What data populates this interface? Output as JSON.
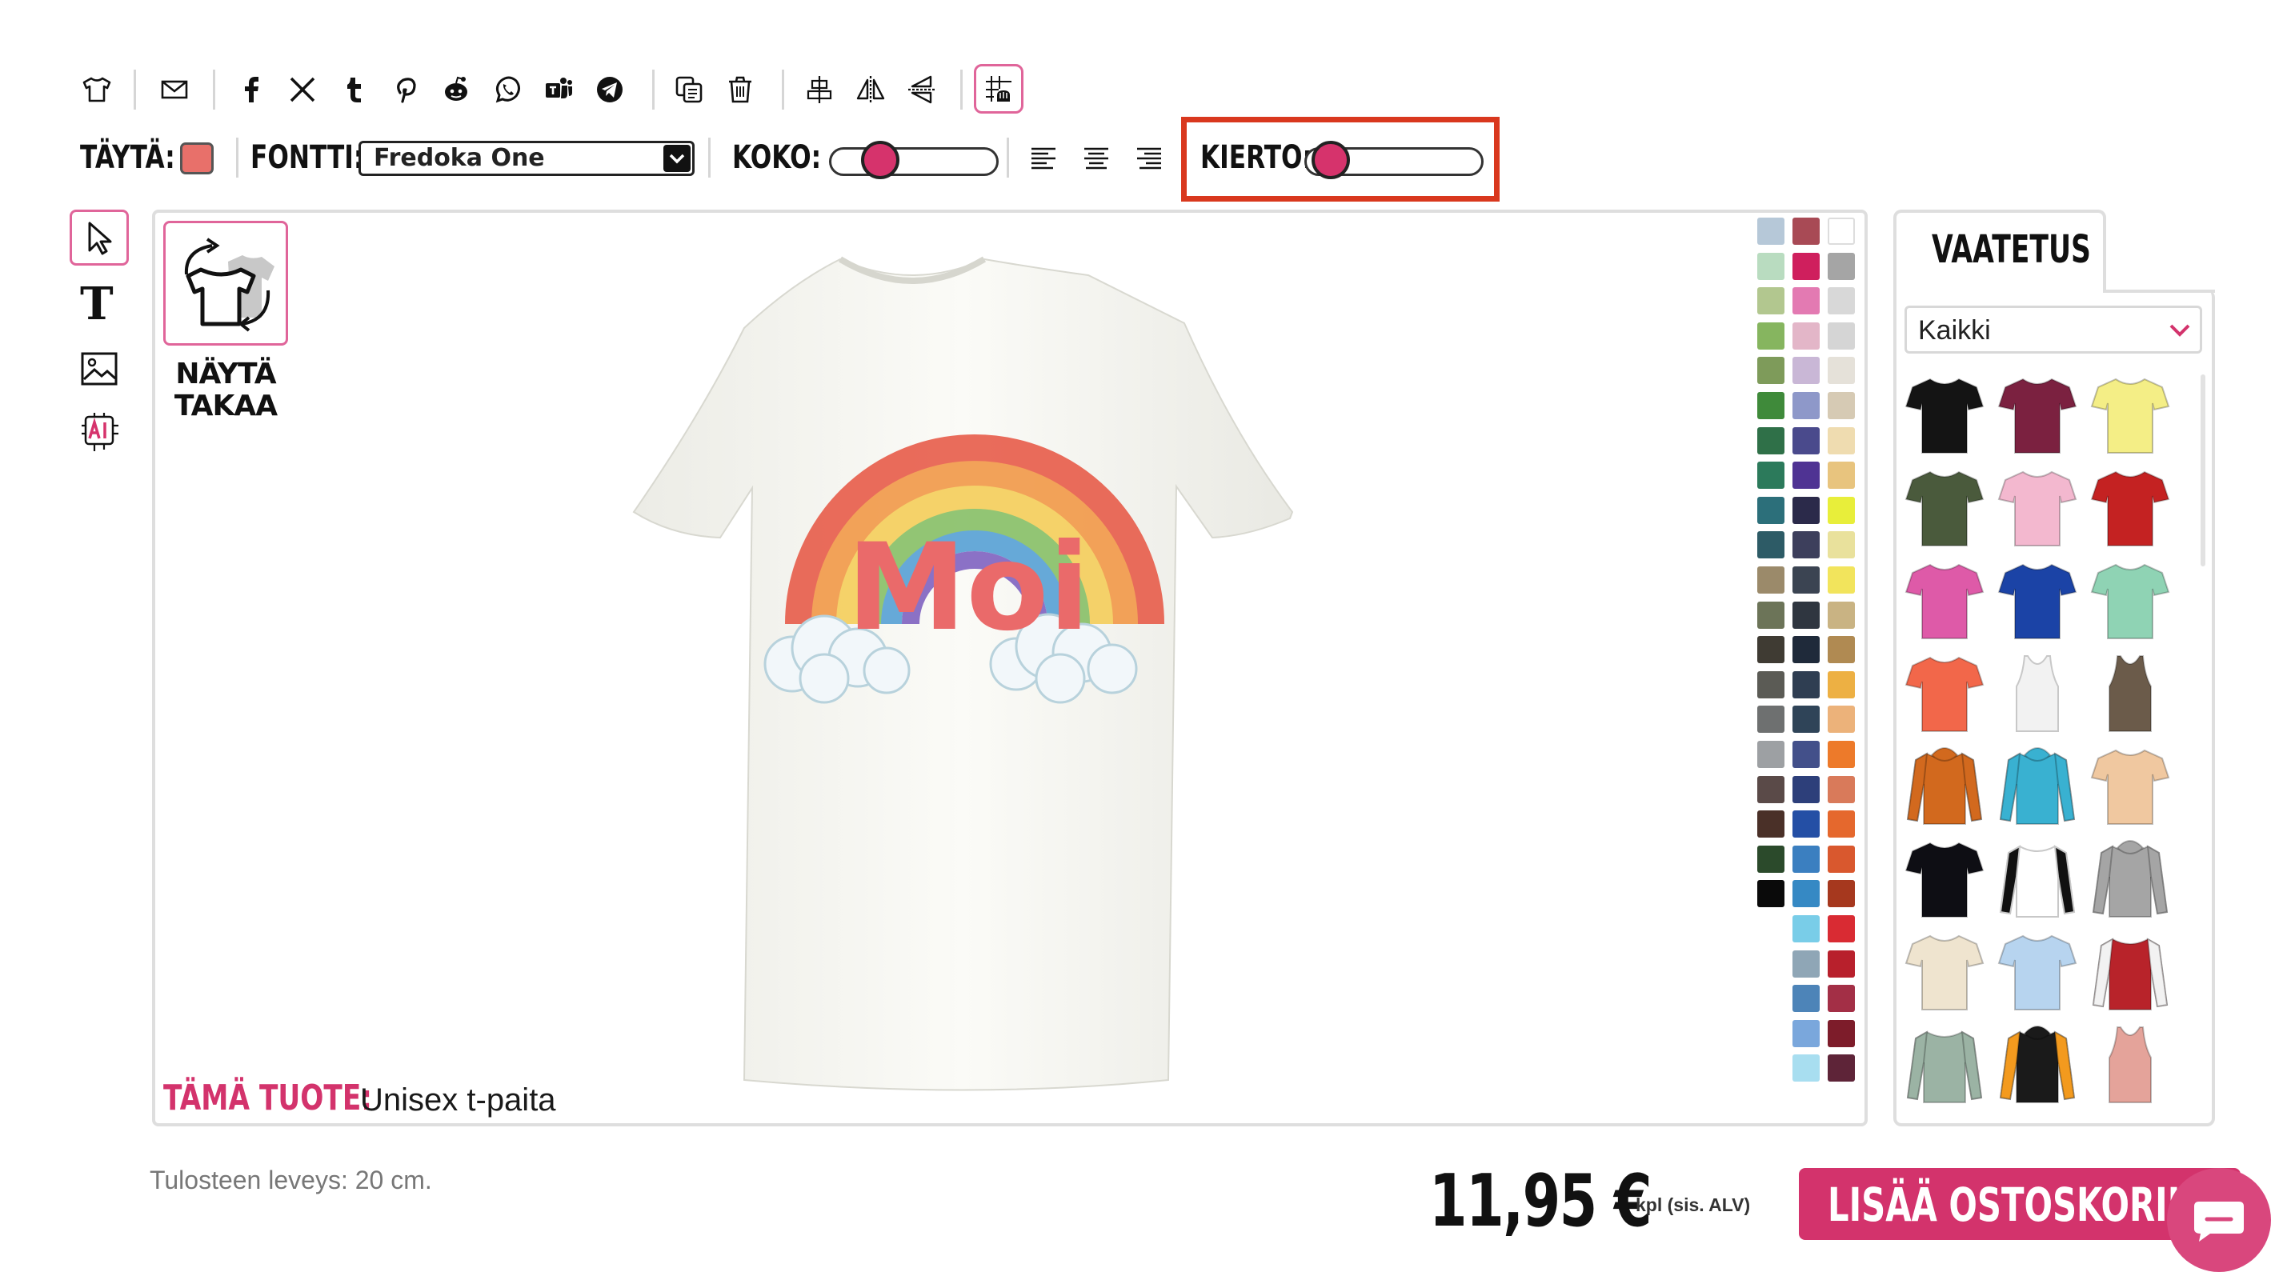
{
  "toolbar": {
    "icons": [
      "tshirt-icon",
      "mail-icon",
      "facebook-icon",
      "x-icon",
      "tumblr-icon",
      "pinterest-icon",
      "reddit-icon",
      "whatsapp-icon",
      "teams-icon",
      "telegram-icon",
      "copy-icon",
      "trash-icon",
      "align-center-icon",
      "flip-horizontal-icon",
      "flip-vertical-icon",
      "grid-snap-icon"
    ],
    "fill_label": "TÄYTÄ:",
    "fill_color": "#e8706a",
    "font_label": "FONTTI:",
    "font_value": "Fredoka One",
    "size_label": "KOKO:",
    "size_level": 0.25,
    "rotation_label": "KIERTO:",
    "rotation_level": 0.05
  },
  "tools": {
    "items": [
      "pointer-icon",
      "text-tool-icon",
      "image-tool-icon",
      "ai-tool-icon"
    ]
  },
  "canvas": {
    "show_back_label": "NÄYTÄ TAKAA",
    "design_text": "Moi",
    "product_label": "TÄMÄ TUOTE:",
    "product_name": "Unisex t-paita",
    "annotation_color": "#d9381e"
  },
  "colors": {
    "col1": [
      "#b6c8d8",
      "#b9dcc0",
      "#b2c78f",
      "#86b55f",
      "#7e9b5a",
      "#3f8a3a",
      "#2f7048",
      "#2c7a5b",
      "#2c6f7a",
      "#2d5b66",
      "#9b8a6a",
      "#6c7458",
      "#3f3b33",
      "#5b5b55",
      "#6e7070",
      "#9da0a3",
      "#5a4a48",
      "#4a3028",
      "#2b4a2b",
      "#0a0a0a"
    ],
    "col2": [
      "#a84a55",
      "#cf1f5d",
      "#e37ab2",
      "#e3b6c8",
      "#c9b7d6",
      "#8e98c9",
      "#4a4a8c",
      "#4f3393",
      "#2b2a4a",
      "#3d3f5c",
      "#3b4452",
      "#2f3640",
      "#1f2a3a",
      "#2f3e52",
      "#2f4458",
      "#43508a",
      "#2d3f7a",
      "#244fa5",
      "#3b7fc0",
      "#3689c4",
      "#79cde8",
      "#8fa6b6",
      "#4d84b8",
      "#7aa7dc",
      "#a8def0"
    ],
    "col3": [
      "#ffffff",
      "#a5a5a5",
      "#d8d8d8",
      "#d5d5d5",
      "#e5e1d9",
      "#d6cab4",
      "#efdcb0",
      "#e8c47e",
      "#e8ee3a",
      "#e9e19c",
      "#f2e45c",
      "#c9b383",
      "#b08a52",
      "#edb043",
      "#ecb27a",
      "#ed7a2a",
      "#d97a5a",
      "#e5682d",
      "#d9582e",
      "#a6381e",
      "#d92b33",
      "#b8202c",
      "#a32f46",
      "#7d1c2a",
      "#5e2438"
    ]
  },
  "clothing": {
    "tab_label": "VAATETUS",
    "category_value": "Kaikki",
    "items": [
      {
        "name": "black-tshirt",
        "color": "#141414"
      },
      {
        "name": "burgundy-tshirt",
        "color": "#7b2140"
      },
      {
        "name": "yellow-tshirt",
        "color": "#f4ee86"
      },
      {
        "name": "olive-tshirt",
        "color": "#4a5a3c"
      },
      {
        "name": "pink-tshirt",
        "color": "#f3b8cf"
      },
      {
        "name": "red-tshirt",
        "color": "#c42222"
      },
      {
        "name": "fuchsia-tshirt",
        "color": "#de5aa8"
      },
      {
        "name": "royal-blue-tshirt",
        "color": "#1b43a6"
      },
      {
        "name": "mint-tshirt",
        "color": "#8fd3b4"
      },
      {
        "name": "coral-tshirt",
        "color": "#f2674a"
      },
      {
        "name": "white-tank",
        "color": "#f2f2f2"
      },
      {
        "name": "brown-tank",
        "color": "#6b5b4a"
      },
      {
        "name": "orange-hoodie",
        "color": "#d2691e"
      },
      {
        "name": "turquoise-hoodie",
        "color": "#39b1d1"
      },
      {
        "name": "tiedye-tshirt",
        "color": "#f0c8a0"
      },
      {
        "name": "black-tshirt-2",
        "color": "#0e0e14"
      },
      {
        "name": "raglan-shirt",
        "color": "#ffffff"
      },
      {
        "name": "grey-hoodie",
        "color": "#a5a5a5"
      },
      {
        "name": "cream-tshirt",
        "color": "#efe4cf"
      },
      {
        "name": "fade-tshirt",
        "color": "#b7d4ef"
      },
      {
        "name": "varsity-jacket",
        "color": "#b8232a"
      },
      {
        "name": "sage-longsleeve",
        "color": "#9bb3a4"
      },
      {
        "name": "black-orange-hoodie",
        "color": "#1a1a1a"
      },
      {
        "name": "rose-tank",
        "color": "#e4a39a"
      }
    ]
  },
  "footer": {
    "print_width": "Tulosteen leveys: 20 cm.",
    "price": "11,95 €",
    "price_unit": "kpl (sis. ALV)",
    "add_to_cart": "LISÄÄ OSTOSKORIIN",
    "accent": "#d3336c"
  }
}
